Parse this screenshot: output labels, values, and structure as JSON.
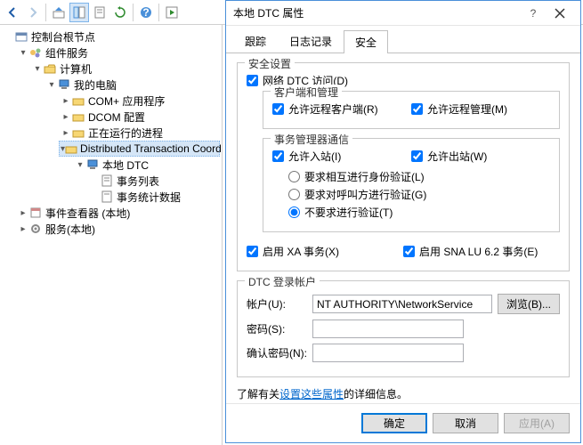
{
  "tree": {
    "root": "控制台根节点",
    "svc": "组件服务",
    "comp": "计算机",
    "mypc": "我的电脑",
    "complus": "COM+ 应用程序",
    "dcom": "DCOM 配置",
    "running": "正在运行的进程",
    "dtc": "Distributed Transaction Coordinator",
    "localdtc": "本地 DTC",
    "txlist": "事务列表",
    "txstats": "事务统计数据",
    "evtviewer": "事件查看器 (本地)",
    "services": "服务(本地)"
  },
  "dialog": {
    "title": "本地 DTC 属性",
    "tabs": {
      "trace": "跟踪",
      "log": "日志记录",
      "security": "安全"
    },
    "sec": {
      "group": "安全设置",
      "netdtc": "网络 DTC 访问(D)",
      "client_group": "客户端和管理",
      "allow_remote_client": "允许远程客户端(R)",
      "allow_remote_admin": "允许远程管理(M)",
      "tm_group": "事务管理器通信",
      "allow_inbound": "允许入站(I)",
      "allow_outbound": "允许出站(W)",
      "mutual_auth": "要求相互进行身份验证(L)",
      "caller_auth": "要求对呼叫方进行验证(G)",
      "no_auth": "不要求进行验证(T)",
      "enable_xa": "启用 XA 事务(X)",
      "enable_sna": "启用 SNA LU 6.2 事务(E)",
      "logon_group": "DTC 登录帐户",
      "account_lbl": "帐户(U):",
      "account_val": "NT AUTHORITY\\NetworkService",
      "browse": "浏览(B)...",
      "password_lbl": "密码(S):",
      "confirm_lbl": "确认密码(N):",
      "info_prefix": "了解有关",
      "info_link": "设置这些属性",
      "info_suffix": "的详细信息。"
    },
    "buttons": {
      "ok": "确定",
      "cancel": "取消",
      "apply": "应用(A)"
    }
  }
}
